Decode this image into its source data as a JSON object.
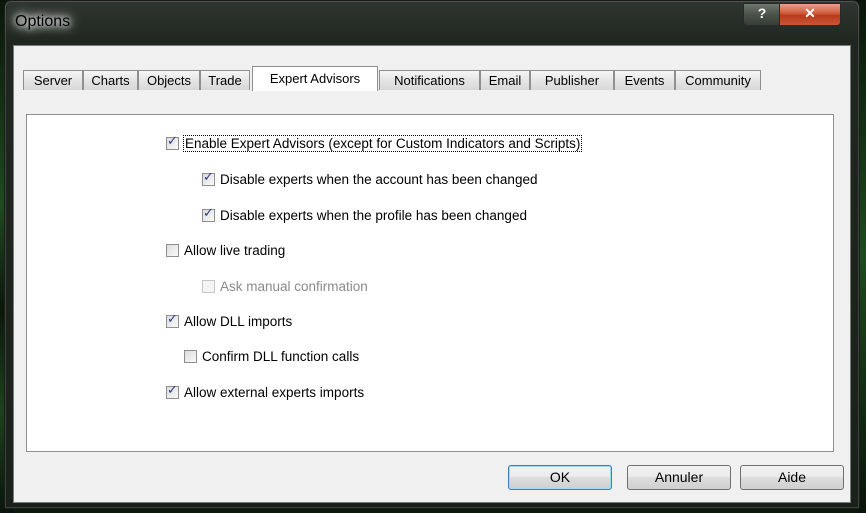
{
  "window": {
    "title": "Options",
    "help_label": "?",
    "close_label": "✕"
  },
  "tabs": [
    {
      "label": "Server"
    },
    {
      "label": "Charts"
    },
    {
      "label": "Objects"
    },
    {
      "label": "Trade"
    },
    {
      "label": "Expert Advisors",
      "active": true
    },
    {
      "label": "Notifications"
    },
    {
      "label": "Email"
    },
    {
      "label": "Publisher"
    },
    {
      "label": "Events"
    },
    {
      "label": "Community"
    }
  ],
  "options": [
    {
      "label": "Enable Expert Advisors (except for Custom Indicators and Scripts)",
      "checked": true,
      "enabled": true
    },
    {
      "label": "Disable experts when the account has been changed",
      "checked": true,
      "enabled": true
    },
    {
      "label": "Disable experts when the profile has been changed",
      "checked": true,
      "enabled": true
    },
    {
      "label": "Allow live trading",
      "checked": false,
      "enabled": true
    },
    {
      "label": "Ask manual confirmation",
      "checked": false,
      "enabled": false
    },
    {
      "label": "Allow DLL imports",
      "checked": true,
      "enabled": true
    },
    {
      "label": "Confirm DLL function calls",
      "checked": false,
      "enabled": true
    },
    {
      "label": "Allow external experts imports",
      "checked": true,
      "enabled": true
    }
  ],
  "buttons": {
    "ok": "OK",
    "cancel": "Annuler",
    "help": "Aide"
  }
}
